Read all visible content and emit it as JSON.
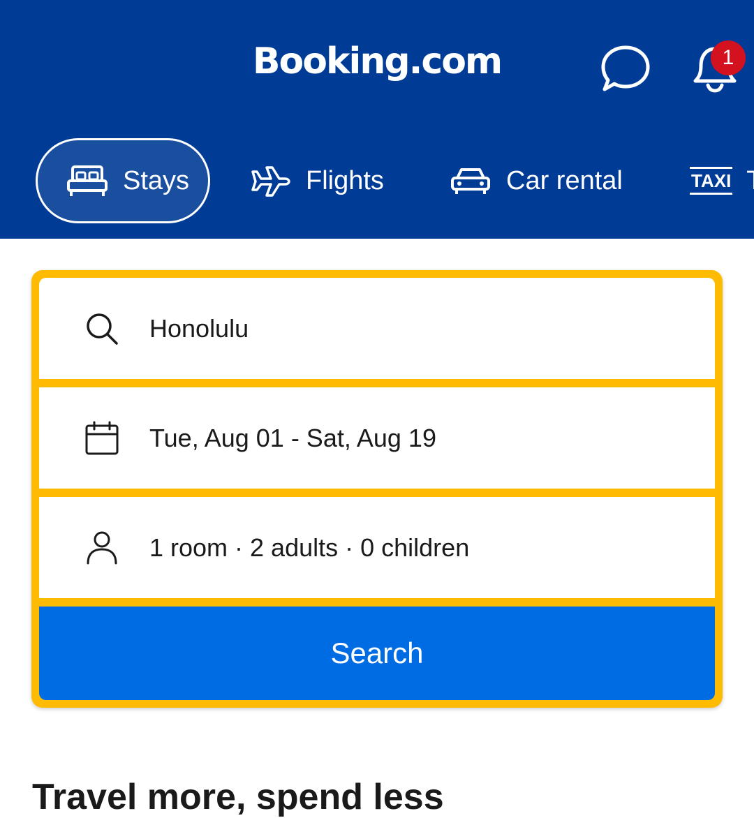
{
  "header": {
    "logo": "Booking.com",
    "notification_count": "1",
    "icons": [
      "chat-icon",
      "bell-icon"
    ]
  },
  "tabs": [
    {
      "label": "Stays",
      "icon": "bed-icon",
      "active": true
    },
    {
      "label": "Flights",
      "icon": "plane-icon",
      "active": false
    },
    {
      "label": "Car rental",
      "icon": "car-icon",
      "active": false
    },
    {
      "label": "T",
      "icon": "taxi-icon",
      "active": false
    }
  ],
  "taxi_icon_text": "TAXI",
  "search": {
    "destination": "Honolulu",
    "dates": "Tue, Aug 01 - Sat, Aug 19",
    "guests": "1 room · 2 adults · 0 children",
    "button_label": "Search"
  },
  "section": {
    "title": "Travel more, spend less"
  },
  "colors": {
    "brand_blue": "#003b95",
    "search_border": "#febb02",
    "button_blue": "#006ce4",
    "badge_red": "#d4111e"
  }
}
